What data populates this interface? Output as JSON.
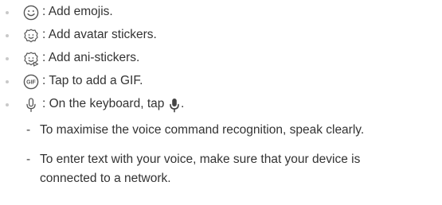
{
  "items": [
    {
      "icon": "smiley-face-icon",
      "text": ": Add emojis."
    },
    {
      "icon": "avatar-sticker-icon",
      "text": ": Add avatar stickers."
    },
    {
      "icon": "ani-sticker-icon",
      "text": ": Add ani-stickers."
    },
    {
      "icon": "gif-icon",
      "text": ": Tap to add a GIF."
    },
    {
      "icon": "microphone-icon",
      "text_before": ": On the keyboard, tap",
      "text_after": "."
    }
  ],
  "notes": [
    {
      "lines": [
        "To maximise the voice command recognition, speak clearly."
      ]
    },
    {
      "lines": [
        "To enter text with your voice, make sure that your device is",
        "connected to a network."
      ]
    }
  ],
  "colors": {
    "text": "#333333",
    "bullet": "#c9c9c9",
    "icon_stroke": "#555555"
  }
}
